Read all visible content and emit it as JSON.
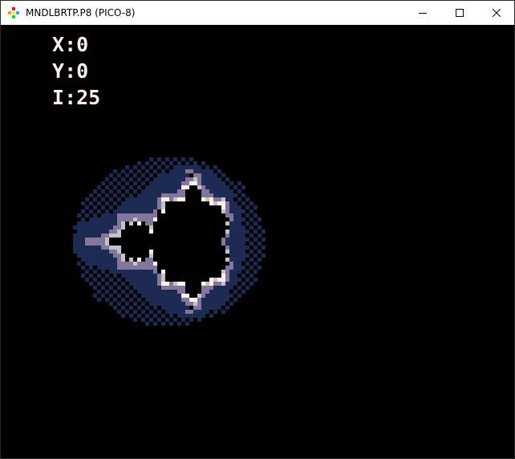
{
  "window": {
    "title": "MNDLBRTP.P8 (PICO-8)",
    "icons": {
      "app": "pico8-logo-icon",
      "minimize": "minimize-icon",
      "maximize": "maximize-icon",
      "close": "close-icon"
    }
  },
  "hud": {
    "x_label": "X",
    "x_value": "0",
    "y_label": "Y",
    "y_value": "0",
    "i_label": "I",
    "i_value": "25"
  },
  "fractal": {
    "name": "mandelbrot-set",
    "center": [
      0,
      0
    ],
    "iterations": 25
  },
  "palette": {
    "background": "#000000",
    "inside": "#000000",
    "edge": "#fff1e8",
    "near": "#c2c3c7",
    "mid": "#83769c",
    "band": "#1d2b53",
    "outer": "#1d2b53"
  }
}
